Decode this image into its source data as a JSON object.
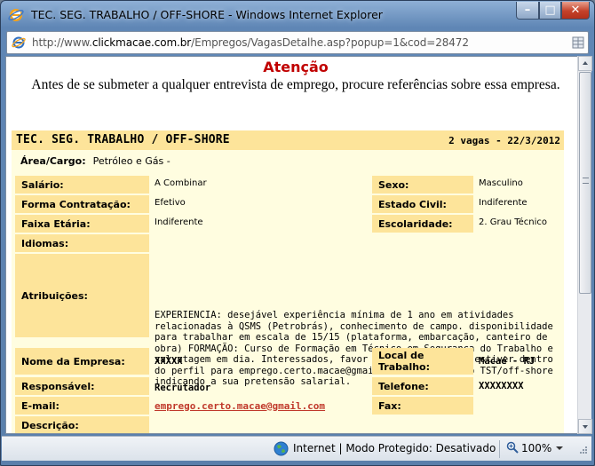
{
  "window": {
    "title": "TEC. SEG. TRABALHO / OFF-SHORE - Windows Internet Explorer",
    "controls": {
      "minimize": "–",
      "maximize": "□",
      "close": "✕"
    }
  },
  "address": {
    "prefix": "http://www.",
    "domain": "clickmacae.com.br",
    "path": "/Empregos/VagasDetalhe.asp?popup=1&cod=28472"
  },
  "notice": {
    "heading": "Atenção",
    "text": "Antes de se submeter a qualquer entrevista de emprego, procure referências sobre essa empresa."
  },
  "job": {
    "title": "TEC. SEG. TRABALHO / OFF-SHORE",
    "vagas": "2 vagas - 22/3/2012",
    "area_label": "Área/Cargo:",
    "area_value": "Petróleo e Gás -",
    "salario_label": "Salário:",
    "salario_value": "A Combinar",
    "sexo_label": "Sexo:",
    "sexo_value": "Masculino",
    "contratacao_label": "Forma Contratação:",
    "contratacao_value": "Efetivo",
    "estado_label": "Estado Civil:",
    "estado_value": "Indiferente",
    "faixa_label": "Faixa Etária:",
    "faixa_value": "Indiferente",
    "escolaridade_label": "Escolaridade:",
    "escolaridade_value": "2. Grau Técnico",
    "idiomas_label": "Idiomas:",
    "atribuicoes_label": "Atribuições:",
    "atribuicoes_value": "EXPERIENCIA: desejável experiência mínima de 1 ano em atividades relacionadas à QSMS (Petrobrás), conhecimento de campo. disponibilidade para trabalhar em escala de 15/15 (plataforma, embarcação, canteiro de obra) FORMAÇÃO: Curso de Formação em Técnico em Segurança do Trabalho e salvatagem em dia. Interessados, favor enviar somente se estiver dentro do perfil para emprego.certo.macae@gmail.com sob o título TST/off-shore indicando a sua pretensão salarial.",
    "empresa_label": "Nome da Empresa:",
    "empresa_value": "XXXXX",
    "local_label": "Local de Trabalho:",
    "local_value": "Macaé - RJ",
    "responsavel_label": "Responsável:",
    "responsavel_value": "Recrutador",
    "telefone_label": "Telefone:",
    "telefone_value": "XXXXXXXX",
    "email_label": "E-mail:",
    "email_value": "emprego.certo.macae@gmail.com",
    "fax_label": "Fax:",
    "descricao_label": "Descrição:"
  },
  "status": {
    "zone": "Internet | Modo Protegido: Desativado",
    "zoom": "100%"
  },
  "colors": {
    "label_bg": "#fde49a",
    "panel_bg": "#fffde0",
    "heading_red": "#c00000",
    "link": "#c0392b"
  }
}
